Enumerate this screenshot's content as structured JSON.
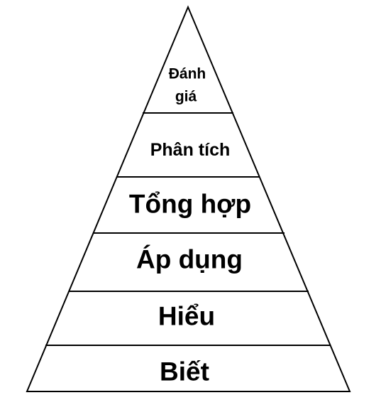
{
  "pyramid": {
    "levels": [
      {
        "lines": [
          "Đánh",
          "giá"
        ]
      },
      {
        "lines": [
          "Phân tích"
        ]
      },
      {
        "lines": [
          "Tổng hợp"
        ]
      },
      {
        "lines": [
          "Áp dụng"
        ]
      },
      {
        "lines": [
          "Hiểu"
        ]
      },
      {
        "lines": [
          "Biết"
        ]
      }
    ],
    "colors": {
      "fill": "#ffffff",
      "stroke": "#000000",
      "text": "#000000"
    }
  }
}
